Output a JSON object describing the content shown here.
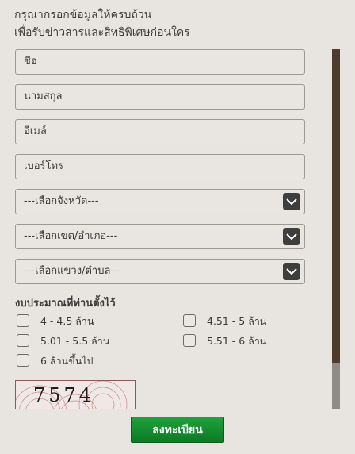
{
  "heading": {
    "line1": "กรุณากรอกข้อมูลให้ครบถ้วน",
    "line2": "เพื่อรับข่าวสารและสิทธิพิเศษก่อนใคร"
  },
  "form": {
    "name_placeholder": "ชื่อ",
    "surname_placeholder": "นามสกุล",
    "email_placeholder": "อีเมล์",
    "phone_placeholder": "เบอร์โทร",
    "province_select": "---เลือกจังหวัด---",
    "district_select": "---เลือกเขต/อำเภอ---",
    "subdistrict_select": "---เลือกแขวง/ตำบล---"
  },
  "budget": {
    "label": "งบประมาณที่ท่านตั้งไว้",
    "options": [
      "4 - 4.5 ล้าน",
      "4.51 - 5 ล้าน",
      "5.01 - 5.5 ล้าน",
      "5.51 - 6 ล้าน",
      "6 ล้านขึ้นไป"
    ]
  },
  "captcha": {
    "code": "7574"
  },
  "submit_label": "ลงทะเบียน"
}
